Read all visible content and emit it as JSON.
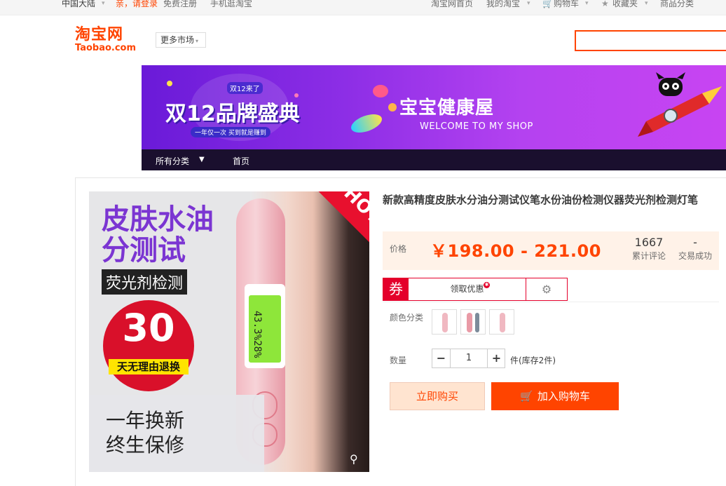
{
  "topbar": {
    "region": "中国大陆",
    "login": "亲，请登录",
    "register": "免费注册",
    "mobile": "手机逛淘宝",
    "home": "淘宝网首页",
    "my_taobao": "我的淘宝",
    "cart": "购物车",
    "favorites": "收藏夹",
    "categories": "商品分类"
  },
  "logo": {
    "cn": "淘宝网",
    "en": "Taobao.com"
  },
  "header": {
    "more_market": "更多市场"
  },
  "banner": {
    "promo_small": "双12来了",
    "promo_big": "双12品牌盛典",
    "promo_tag": "一年仅一次 买到就是赚到",
    "shop_name": "宝宝健康屋",
    "welcome": "WELCOME TO MY SHOP"
  },
  "shop_nav": {
    "all_categories": "所有分类",
    "home": "首页"
  },
  "main_image": {
    "line1": "皮肤水油",
    "line2": "分测试",
    "line3": "荧光剂检测",
    "badge_number": "30",
    "badge_text": "天无理由退换",
    "bottom1": "一年换新",
    "bottom2": "终生保修",
    "hot": "HOT",
    "lcd": "43.3%28%"
  },
  "product": {
    "title": "新款高精度皮肤水分油分测试仪笔水份油份检测仪器荧光剂检测灯笔",
    "price_label": "价格",
    "price": "￥198.00 - 221.00",
    "reviews_count": "1667",
    "reviews_label": "累计评论",
    "deals_count": "-",
    "deals_label": "交易成功",
    "coupon_icon": "券",
    "coupon_text": "领取优惠",
    "color_label": "颜色分类",
    "qty_label": "数量",
    "qty_minus": "−",
    "qty_value": "1",
    "qty_plus": "+",
    "stock": "件(库存2件)",
    "buy_now": "立即购买",
    "add_to_cart": "加入购物车"
  },
  "colors": {
    "accent": "#ff4400",
    "coupon_red": "#e4002b",
    "banner_purple": "#8d2ee6"
  }
}
